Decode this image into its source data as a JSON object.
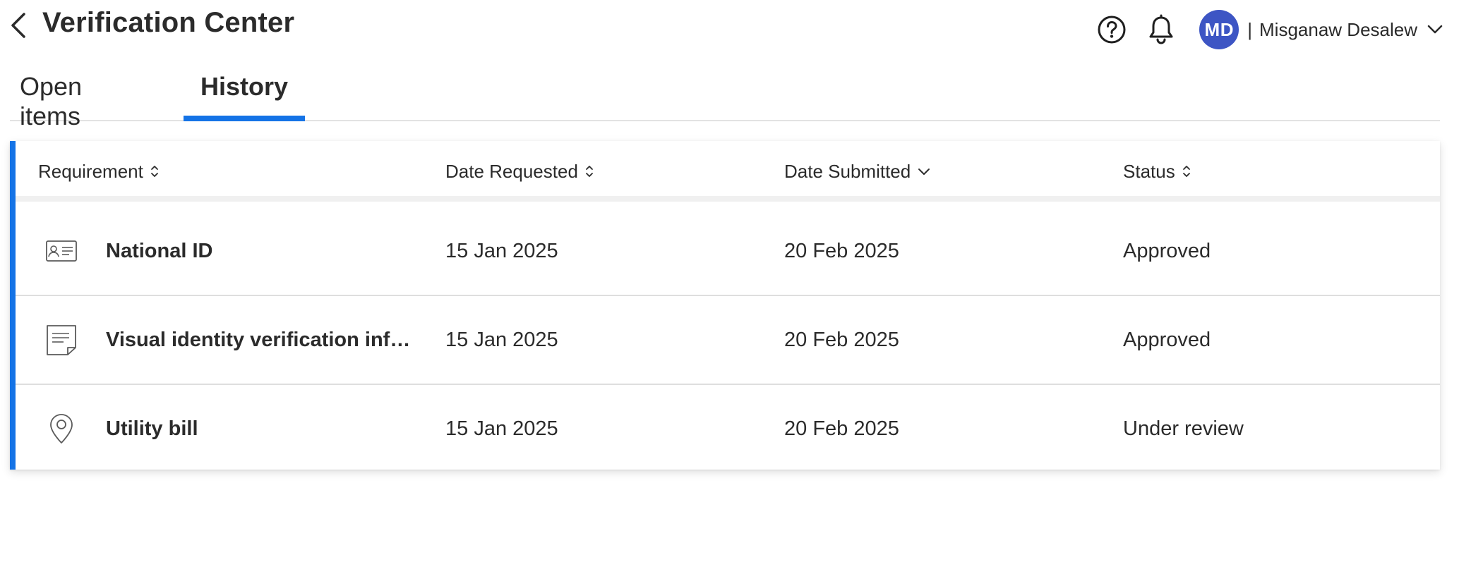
{
  "header": {
    "title": "Verification Center",
    "user": {
      "initials": "MD",
      "separator": "|",
      "name": "Misganaw Desalew"
    },
    "icons": [
      "back-chevron-icon",
      "help-icon",
      "bell-icon",
      "chevron-down-icon"
    ]
  },
  "tabs": [
    {
      "label": "Open items",
      "active": false
    },
    {
      "label": "History",
      "active": true
    }
  ],
  "table": {
    "columns": [
      {
        "label": "Requirement",
        "sort": "unsorted"
      },
      {
        "label": "Date Requested",
        "sort": "unsorted"
      },
      {
        "label": "Date Submitted",
        "sort": "descending"
      },
      {
        "label": "Status",
        "sort": "unsorted"
      }
    ],
    "rows": [
      {
        "icon": "id-card-icon",
        "requirement": "National ID",
        "date_requested": "15 Jan 2025",
        "date_submitted": "20 Feb 2025",
        "status": "Approved"
      },
      {
        "icon": "document-icon",
        "requirement": "Visual identity verification inf…",
        "date_requested": "15 Jan 2025",
        "date_submitted": "20 Feb 2025",
        "status": "Approved"
      },
      {
        "icon": "location-pin-icon",
        "requirement": "Utility bill",
        "date_requested": "15 Jan 2025",
        "date_submitted": "20 Feb 2025",
        "status": "Under review"
      }
    ]
  },
  "colors": {
    "accent": "#1473e6",
    "avatar": "#3d55c4",
    "text": "#2b2b2b"
  }
}
